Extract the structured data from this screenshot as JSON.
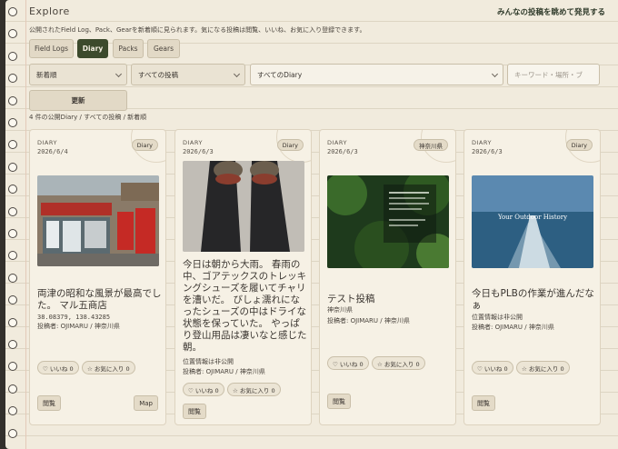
{
  "header": {
    "title": "Explore",
    "link": "みんなの投稿を眺めて発見する",
    "description": "公開されたField Log、Pack、Gearを新着順に見られます。気になる投稿は閲覧、いいね、お気に入り登録できます。"
  },
  "tabs": [
    {
      "label": "Field Logs",
      "active": false
    },
    {
      "label": "Diary",
      "active": true
    },
    {
      "label": "Packs",
      "active": false
    },
    {
      "label": "Gears",
      "active": false
    }
  ],
  "filters": {
    "sort": "新着順",
    "scope": "すべての投稿",
    "category": "すべてのDiary",
    "search_placeholder": "キーワード・場所・ブ"
  },
  "refresh_label": "更新",
  "result_summary": "4 件の公開Diary / すべての投稿 / 新着順",
  "colors": {
    "accent": "#3c4a2c",
    "paper": "#f1ebdd",
    "binding": "#33302c"
  },
  "cards": [
    {
      "type": "DIARY",
      "date": "2026/6/4",
      "tag": "Diary",
      "title": "両津の昭和な風景が最高でした。 マル五商店",
      "coords": "38.08379, 138.43285",
      "author": "投稿者: OJIMARU / 神奈川県",
      "location_note": "",
      "like": "♡ いいね 0",
      "fav": "☆ お気に入り 0",
      "view": "閲覧",
      "map": "Map"
    },
    {
      "type": "DIARY",
      "date": "2026/6/3",
      "tag": "Diary",
      "title": "今日は朝から大雨。 春雨の中、ゴアテックスのトレッキングシューズを履いてチャリを漕いだ。 びしょ濡れになったシューズの中はドライな状態を保っていた。 やっぱり登山用品は凄いなと感じた朝。",
      "location_note": "位置情報は非公開",
      "author": "投稿者: OJIMARU / 神奈川県",
      "like": "♡ いいね 0",
      "fav": "☆ お気に入り 0",
      "view": "閲覧"
    },
    {
      "type": "DIARY",
      "date": "2026/6/3",
      "tag": "神奈川県",
      "title": "テスト投稿",
      "location_note": "神奈川県",
      "author": "投稿者: OJIMARU / 神奈川県",
      "like": "♡ いいね 0",
      "fav": "☆ お気に入り 0",
      "view": "閲覧"
    },
    {
      "type": "DIARY",
      "date": "2026/6/3",
      "tag": "Diary",
      "title": "今日もPLBの作業が進んだなぁ",
      "location_note": "位置情報は非公開",
      "author": "投稿者: OJIMARU / 神奈川県",
      "photo_caption": "Your Outdoor History",
      "like": "♡ いいね 0",
      "fav": "☆ お気に入り 0",
      "view": "閲覧"
    }
  ]
}
